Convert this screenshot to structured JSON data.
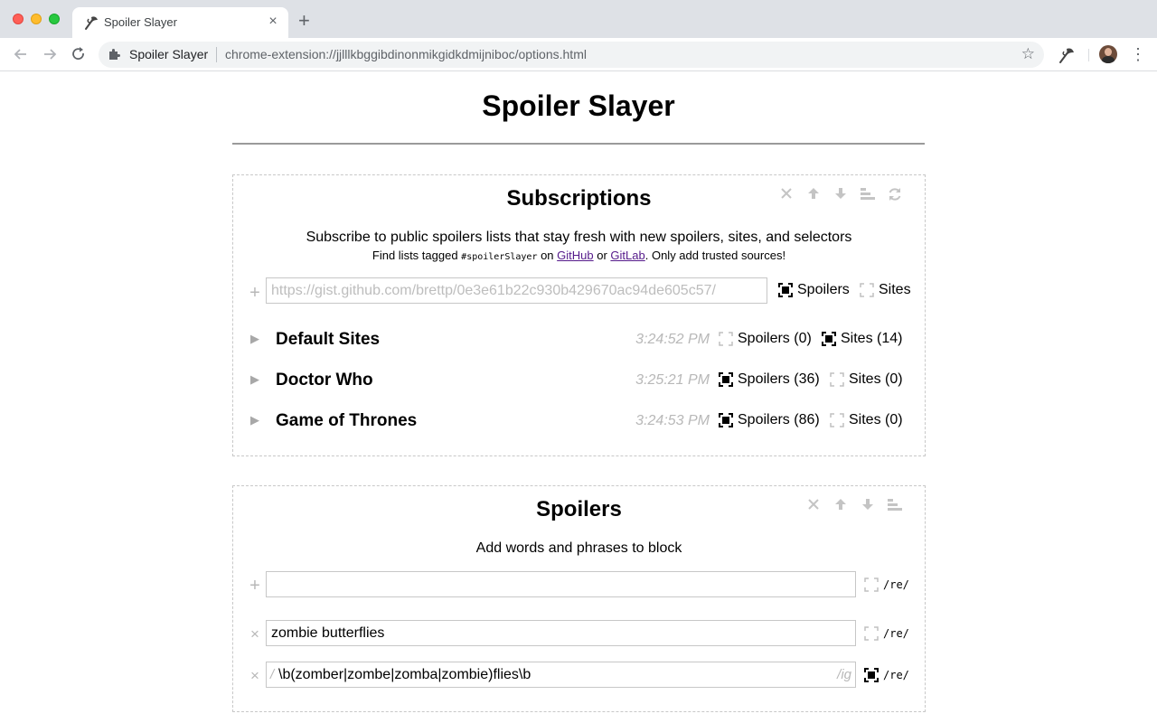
{
  "browser": {
    "tab_title": "Spoiler Slayer",
    "tab_close": "×",
    "new_tab": "+",
    "omnibox_name": "Spoiler Slayer",
    "url": "chrome-extension://jjlllkbggibdinonmikgidkdmijniboc/options.html",
    "star": "☆",
    "menu": "⋮"
  },
  "page": {
    "title": "Spoiler Slayer"
  },
  "subscriptions": {
    "title": "Subscriptions",
    "description": "Subscribe to public spoilers lists that stay fresh with new spoilers, sites, and selectors",
    "find_prefix": "Find lists tagged ",
    "tag": "#spoilerSlayer",
    "find_on": " on ",
    "github": "GitHub",
    "find_or": " or ",
    "gitlab": "GitLab",
    "find_suffix": ". Only add trusted sources!",
    "url_placeholder": "https://gist.github.com/brettp/0e3e61b22c930b429670ac94de605c57/",
    "new_spoilers_label": "Spoilers",
    "new_spoilers_checked": true,
    "new_sites_label": "Sites",
    "new_sites_checked": false,
    "items": [
      {
        "name": "Default Sites",
        "time": "3:24:52 PM",
        "spoilers": "Spoilers (0)",
        "spoilers_checked": false,
        "sites": "Sites (14)",
        "sites_checked": true
      },
      {
        "name": "Doctor Who",
        "time": "3:25:21 PM",
        "spoilers": "Spoilers (36)",
        "spoilers_checked": true,
        "sites": "Sites (0)",
        "sites_checked": false
      },
      {
        "name": "Game of Thrones",
        "time": "3:24:53 PM",
        "spoilers": "Spoilers (86)",
        "spoilers_checked": true,
        "sites": "Sites (0)",
        "sites_checked": false
      }
    ]
  },
  "spoilers": {
    "title": "Spoilers",
    "description": "Add words and phrases to block",
    "new_value": "",
    "re_label": "/re/",
    "items": [
      {
        "value": "zombie butterflies",
        "regex": false
      },
      {
        "value": "\\b(zomber|zombe|zomba|zombie)flies\\b",
        "regex": true,
        "slash": "/",
        "flags": "/ig"
      }
    ]
  },
  "colors": {
    "link": "#551a8b",
    "muted": "#b8b8b8",
    "panel_border": "#c8c8c8"
  }
}
